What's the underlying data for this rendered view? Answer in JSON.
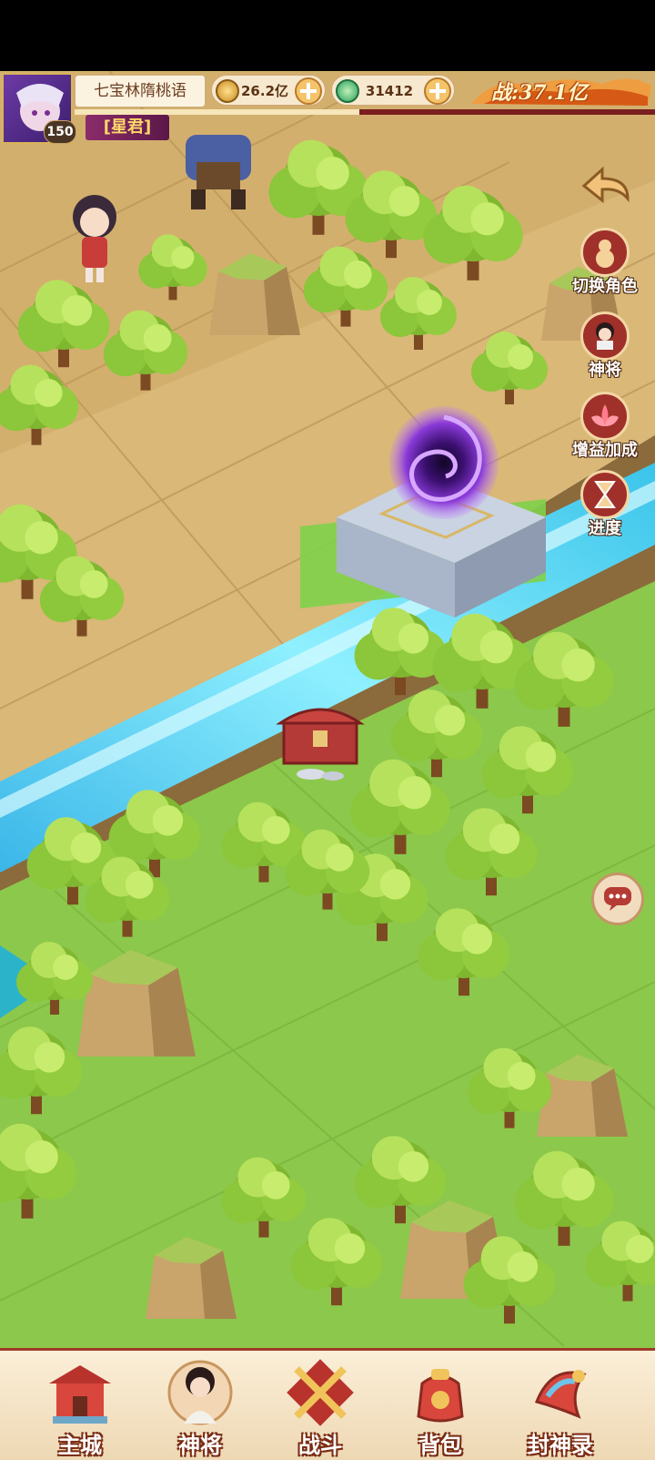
{
  "hud": {
    "player_name": "七宝林隋桃语",
    "level": "150",
    "rank_title": "[星君]",
    "currency_copper": "26.2亿",
    "currency_jade": "31412",
    "battle_power": "战:37.1亿",
    "exp_progress": 0.49
  },
  "side_buttons": [
    {
      "label": "切换角色",
      "icon": "gourd-icon"
    },
    {
      "label": "神将",
      "icon": "hero-portrait-icon"
    },
    {
      "label": "增益加成",
      "icon": "lotus-icon"
    },
    {
      "label": "进度",
      "icon": "hourglass-icon"
    }
  ],
  "bottom_nav": [
    {
      "label": "主城",
      "icon": "city-gate-icon"
    },
    {
      "label": "神将",
      "icon": "hero-icon"
    },
    {
      "label": "战斗",
      "icon": "crossed-swords-icon"
    },
    {
      "label": "背包",
      "icon": "bag-icon"
    },
    {
      "label": "封神录",
      "icon": "scroll-icon"
    }
  ],
  "colors": {
    "grass": "#8cc84b",
    "dirt": "#d9b878",
    "water": "#5fd6f0",
    "portal": "#8a3ad8",
    "accent_red": "#a0302a"
  }
}
